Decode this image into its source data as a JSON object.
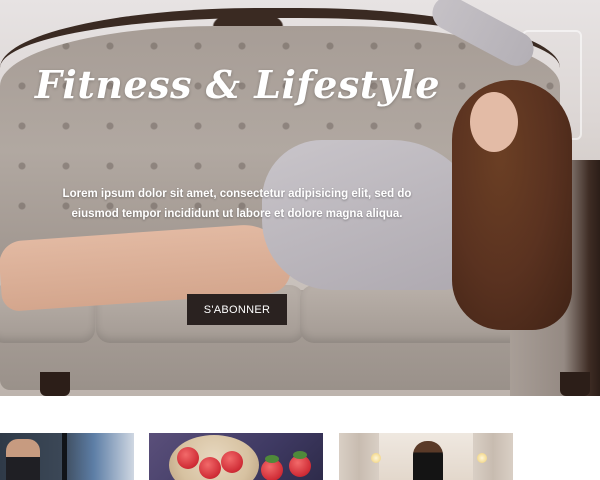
{
  "hero": {
    "title": "Fitness & Lifestyle",
    "text": "Lorem ipsum dolor sit amet, consectetur adipisicing elit, sed do eiusmod tempor incididunt ut labore et dolore magna aliqua.",
    "button_label": "S'ABONNER",
    "button_color": "#2a2220",
    "text_color": "#ffffff"
  },
  "thumbnails": [
    {
      "subject": "gym-workout-photo"
    },
    {
      "subject": "fruit-bowl-photo"
    },
    {
      "subject": "fashion-model-photo"
    }
  ]
}
